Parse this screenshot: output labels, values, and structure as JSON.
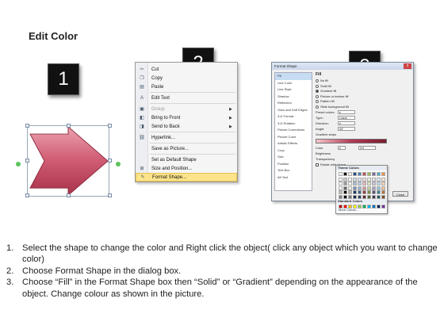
{
  "title": "Edit Color",
  "badges": [
    "1",
    "2",
    "3"
  ],
  "colors": {
    "arrow_fill": "#c9566d",
    "arrow_light": "#eaa3b0",
    "highlight": "#fbe48a",
    "badge_bg": "#111111"
  },
  "context_menu": {
    "items": [
      {
        "label": "Cut",
        "icon": "scissors-icon"
      },
      {
        "label": "Copy",
        "icon": "copy-icon"
      },
      {
        "label": "Paste",
        "icon": "paste-icon"
      },
      {
        "label": "Edit Text",
        "icon": "text-icon"
      },
      {
        "label": "Group",
        "icon": "group-icon",
        "submenu": true,
        "disabled": true
      },
      {
        "label": "Bring to Front",
        "icon": "bring-front-icon",
        "submenu": true
      },
      {
        "label": "Send to Back",
        "icon": "send-back-icon",
        "submenu": true
      },
      {
        "label": "Hyperlink...",
        "icon": "hyperlink-icon"
      },
      {
        "label": "Save as Picture...",
        "icon": ""
      },
      {
        "label": "Set as Default Shape",
        "icon": ""
      },
      {
        "label": "Size and Position...",
        "icon": "size-icon"
      },
      {
        "label": "Format Shape...",
        "icon": "format-icon",
        "highlighted": true
      }
    ]
  },
  "dialog": {
    "title": "Format Shape",
    "close": "x",
    "categories": [
      "Fill",
      "Line Color",
      "Line Style",
      "Shadow",
      "Reflection",
      "Glow and Soft Edges",
      "3-D Format",
      "3-D Rotation",
      "Picture Corrections",
      "Picture Color",
      "Artistic Effects",
      "Crop",
      "Size",
      "Position",
      "Text Box",
      "Alt Text"
    ],
    "fill_heading": "Fill",
    "fill_options": [
      "No fill",
      "Solid fill",
      "Gradient fill",
      "Picture or texture fill",
      "Pattern fill",
      "Slide background fill"
    ],
    "preset_label": "Preset colors:",
    "type_label": "Type:",
    "type_value": "Linear",
    "direction_label": "Direction:",
    "angle_label": "Angle:",
    "angle_value": "90°",
    "stops_label": "Gradient stops",
    "color_label": "Color",
    "position_value": "0%",
    "brightness_label": "Brightness",
    "transparency_label": "Transparency",
    "rotate_label": "Rotate with shape",
    "close_button": "Close"
  },
  "color_popup": {
    "theme_heading": "Theme Colors",
    "standard_heading": "Standard Colors",
    "more_colors": "More Colors...",
    "theme_row": [
      "#ffffff",
      "#000000",
      "#eeece1",
      "#1f497d",
      "#4f81bd",
      "#c0504d",
      "#9bbb59",
      "#8064a2",
      "#4bacc6",
      "#f79646"
    ],
    "standard_row": [
      "#c00000",
      "#ff0000",
      "#ffc000",
      "#ffff00",
      "#92d050",
      "#00b050",
      "#00b0f0",
      "#0070c0",
      "#002060",
      "#7030a0"
    ]
  },
  "instructions": [
    {
      "num": "1.",
      "text": "Select the shape to change the color and Right click the object( click any object which you want to change color)"
    },
    {
      "num": "2.",
      "text": "Choose Format Shape in the dialog box."
    },
    {
      "num": "3.",
      "text": "Choose “Fill” in the Format Shape box then “Solid” or “Gradient” depending on the appearance of the object. Change colour as shown in the picture."
    }
  ]
}
